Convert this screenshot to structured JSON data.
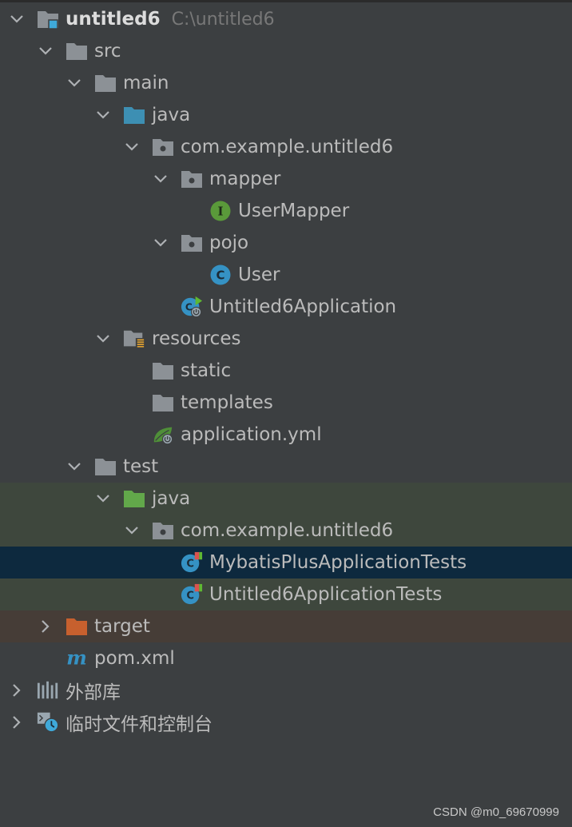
{
  "tree": {
    "project": {
      "name": "untitled6",
      "path": "C:\\untitled6"
    },
    "src": "src",
    "main": "main",
    "main_java": "java",
    "main_package": "com.example.untitled6",
    "mapper": "mapper",
    "user_mapper": "UserMapper",
    "pojo": "pojo",
    "user": "User",
    "app_class": "Untitled6Application",
    "resources": "resources",
    "static": "static",
    "templates": "templates",
    "application_yml": "application.yml",
    "test": "test",
    "test_java": "java",
    "test_package": "com.example.untitled6",
    "mybatis_test": "MybatisPlusApplicationTests",
    "app_tests": "Untitled6ApplicationTests",
    "target": "target",
    "pom": "pom.xml",
    "external_libs": "外部库",
    "scratches": "临时文件和控制台"
  },
  "colors": {
    "background": "#3c3f41",
    "folder_gray": "#8c9196",
    "source_folder_blue": "#3d8fb3",
    "test_folder_green": "#62a84a",
    "excluded_folder_orange": "#c7602e",
    "selection": "#0d293e",
    "test_row": "#3e473d",
    "excluded_row": "#463d37"
  },
  "icons": {
    "interface_letter": "I",
    "class_letter": "C",
    "maven_letter": "m"
  },
  "watermark": "CSDN @m0_69670999"
}
